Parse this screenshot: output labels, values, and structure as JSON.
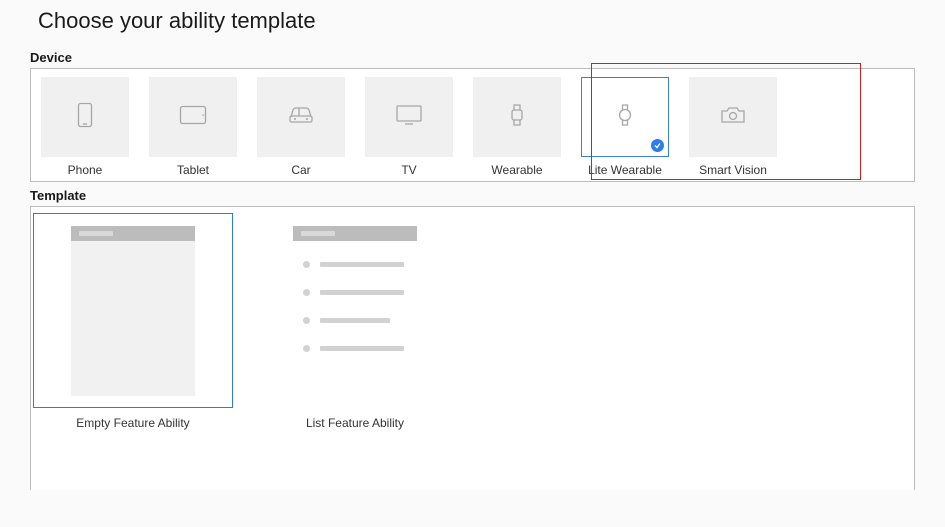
{
  "page": {
    "title": "Choose your ability template"
  },
  "sections": {
    "device_label": "Device",
    "template_label": "Template"
  },
  "devices": [
    {
      "id": "phone",
      "label": "Phone",
      "icon": "phone-icon",
      "selected": false
    },
    {
      "id": "tablet",
      "label": "Tablet",
      "icon": "tablet-icon",
      "selected": false
    },
    {
      "id": "car",
      "label": "Car",
      "icon": "car-icon",
      "selected": false
    },
    {
      "id": "tv",
      "label": "TV",
      "icon": "tv-icon",
      "selected": false
    },
    {
      "id": "wearable",
      "label": "Wearable",
      "icon": "wearable-icon",
      "selected": false
    },
    {
      "id": "litewearable",
      "label": "Lite Wearable",
      "icon": "litewearable-icon",
      "selected": true
    },
    {
      "id": "smartvision",
      "label": "Smart Vision",
      "icon": "camera-icon",
      "selected": false
    }
  ],
  "templates": [
    {
      "id": "empty",
      "label": "Empty Feature Ability",
      "preview": "empty",
      "selected": true
    },
    {
      "id": "list",
      "label": "List Feature Ability",
      "preview": "list",
      "selected": false
    }
  ],
  "annotation": {
    "highlight_device_ids": [
      "litewearable",
      "smartvision"
    ]
  }
}
